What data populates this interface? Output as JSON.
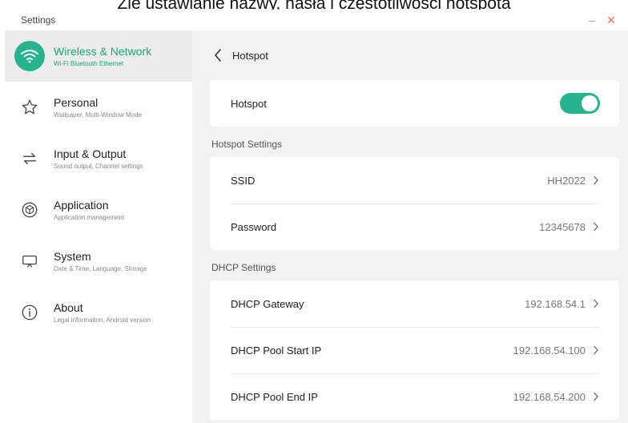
{
  "window": {
    "title": "Settings",
    "minimize_icon": "minimize-icon",
    "close_icon": "close-icon",
    "accent": "#27b38d"
  },
  "caption": "Żle ustawianie nazwy, hasła i częstotliwości hotspota",
  "sidebar": {
    "items": [
      {
        "label": "Wireless & Network",
        "sub": "Wi-Fi Bluetooth Ethernet",
        "icon": "wifi-icon",
        "active": true
      },
      {
        "label": "Personal",
        "sub": "Wallpaper, Multi-Window Mode",
        "icon": "star-icon"
      },
      {
        "label": "Input & Output",
        "sub": "Sound output, Channel settings",
        "icon": "arrows-icon"
      },
      {
        "label": "Application",
        "sub": "Application management",
        "icon": "cube-icon"
      },
      {
        "label": "System",
        "sub": "Date & Time, Language, Storage",
        "icon": "monitor-icon"
      },
      {
        "label": "About",
        "sub": "Legal information, Android version",
        "icon": "info-icon"
      }
    ]
  },
  "main": {
    "title": "Hotspot",
    "back_icon": "back-icon",
    "hotspot_toggle": {
      "label": "Hotspot",
      "state": "on"
    },
    "hotspot_settings": {
      "title": "Hotspot Settings",
      "rows": [
        {
          "label": "SSID",
          "value": "HH2022"
        },
        {
          "label": "Password",
          "value": "12345678"
        }
      ]
    },
    "dhcp_settings": {
      "title": "DHCP Settings",
      "rows": [
        {
          "label": "DHCP Gateway",
          "value": "192.168.54.1"
        },
        {
          "label": "DHCP Pool Start IP",
          "value": "192.168.54.100"
        },
        {
          "label": "DHCP Pool End IP",
          "value": "192.168.54.200"
        }
      ]
    }
  }
}
